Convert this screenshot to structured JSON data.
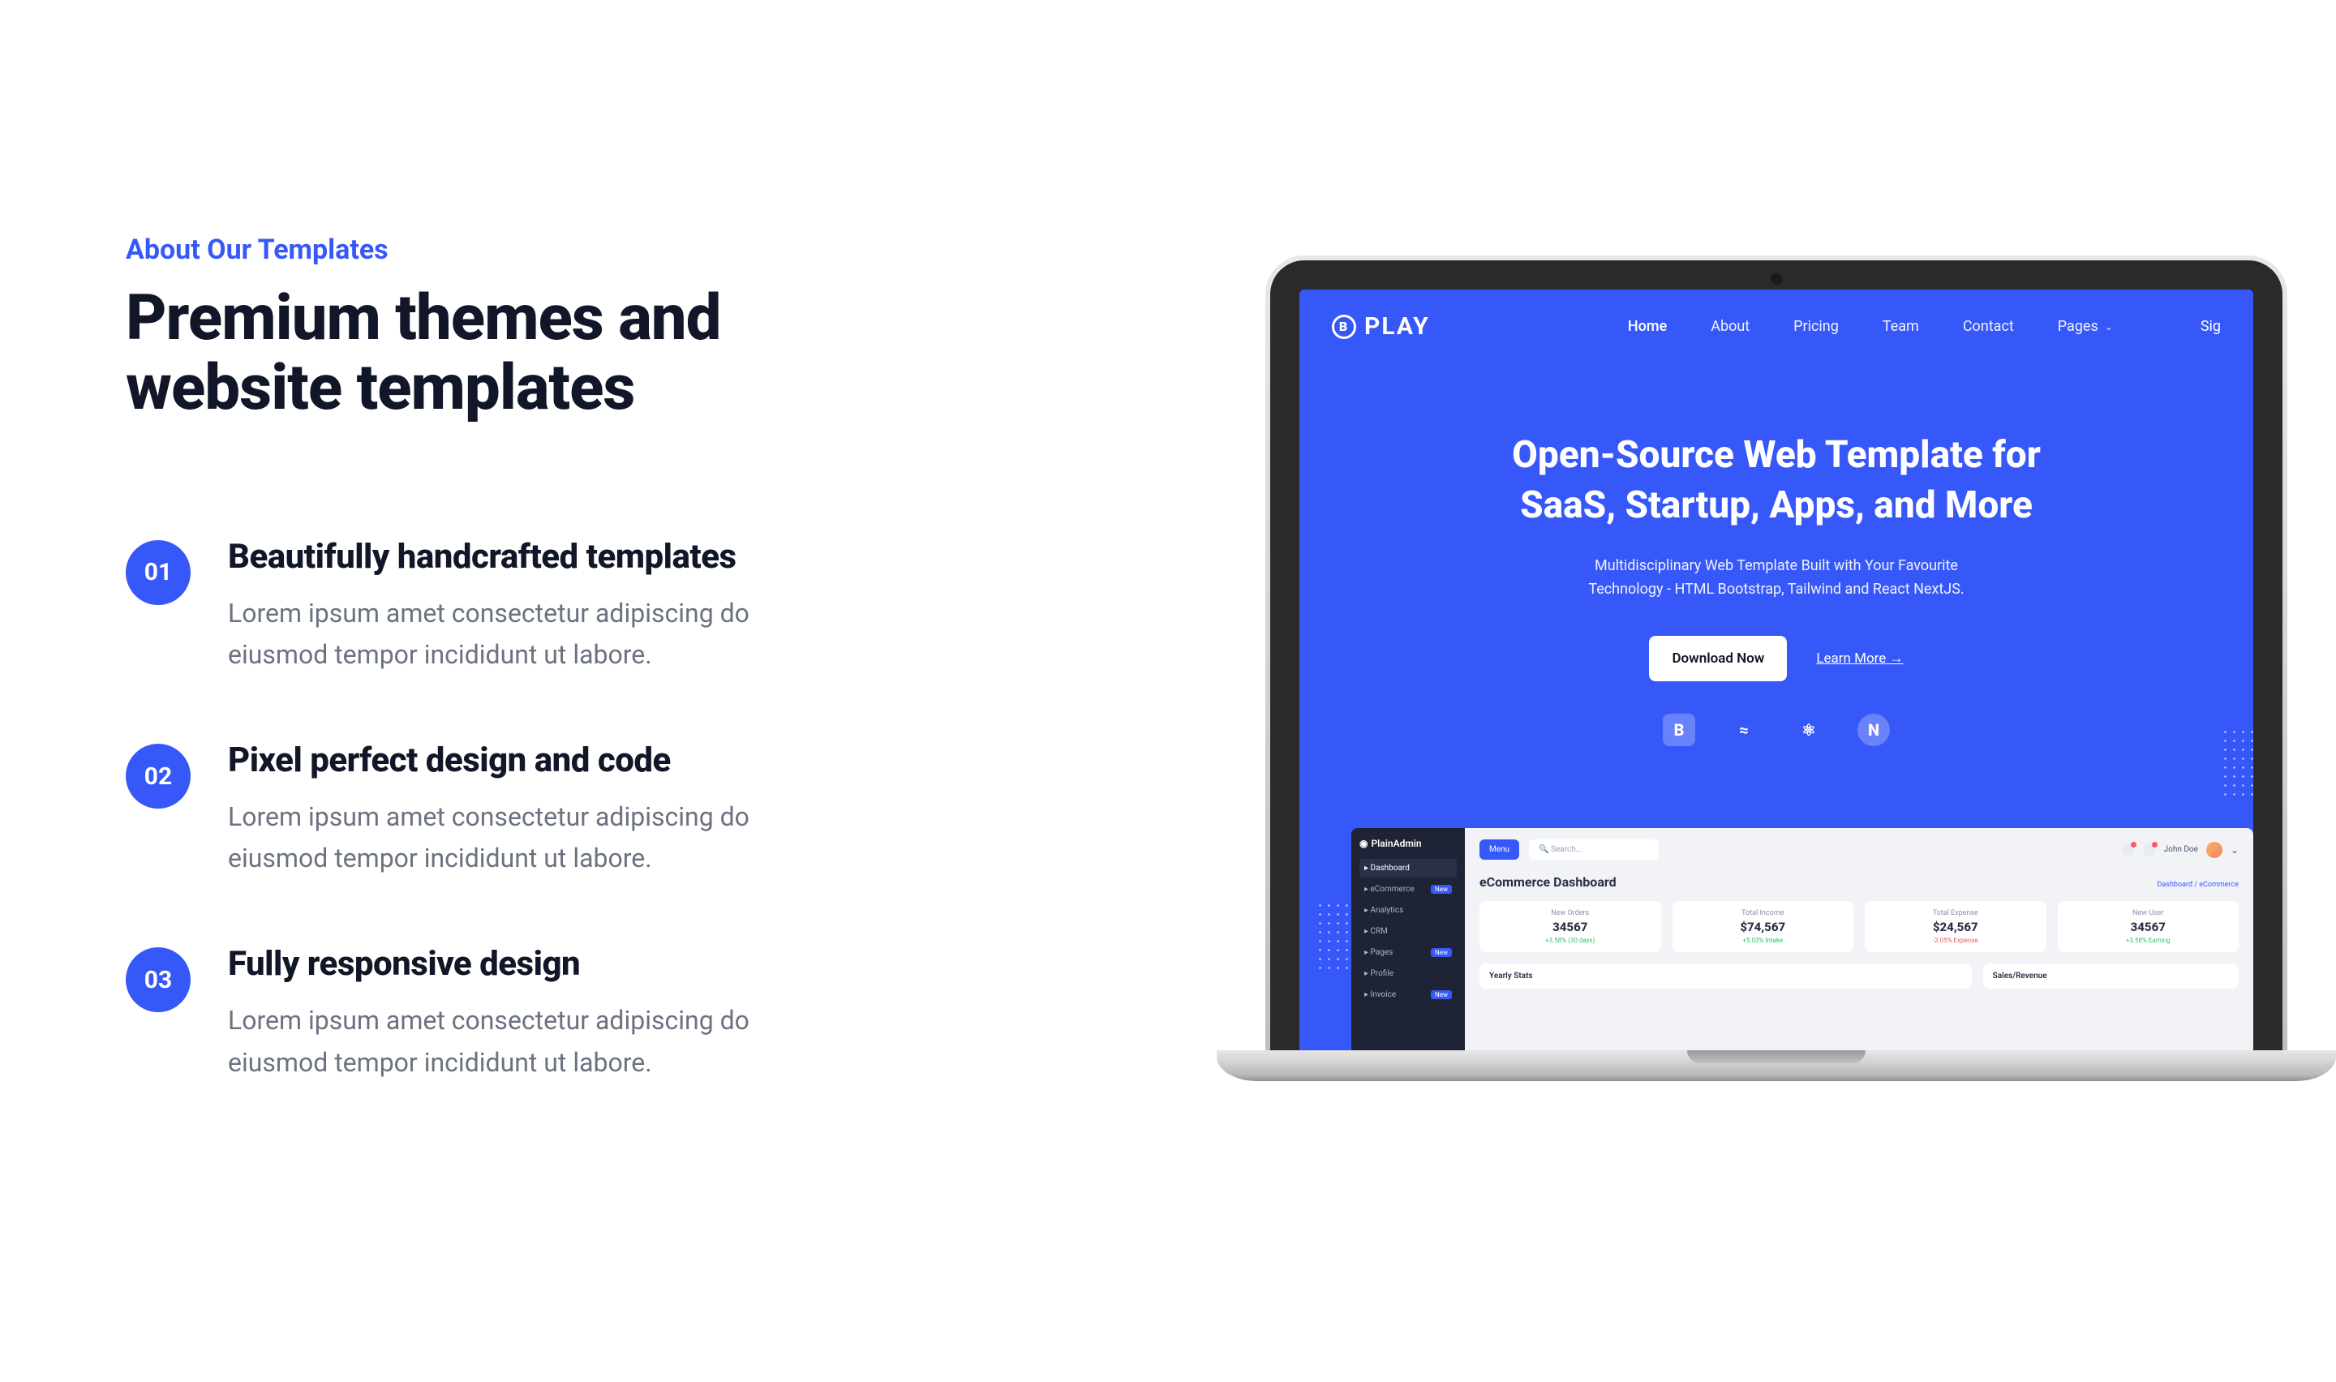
{
  "subtitle": "About Our Templates",
  "title_line1": "Premium themes and",
  "title_line2": "website templates",
  "features": [
    {
      "num": "01",
      "title": "Beautifully handcrafted templates",
      "desc": "Lorem ipsum amet consectetur adipiscing do eiusmod tempor incididunt ut labore."
    },
    {
      "num": "02",
      "title": "Pixel perfect design and code",
      "desc": "Lorem ipsum amet consectetur adipiscing do eiusmod tempor incididunt ut labore."
    },
    {
      "num": "03",
      "title": "Fully responsive design",
      "desc": "Lorem ipsum amet consectetur adipiscing do eiusmod tempor incididunt ut labore."
    }
  ],
  "mock": {
    "logo": "PLAY",
    "nav": {
      "home": "Home",
      "about": "About",
      "pricing": "Pricing",
      "team": "Team",
      "contact": "Contact",
      "pages": "Pages",
      "signin": "Sig"
    },
    "hero": {
      "line1": "Open-Source Web Template for",
      "line2": "SaaS, Startup, Apps, and More",
      "sub1": "Multidisciplinary Web Template Built with Your Favourite",
      "sub2": "Technology - HTML Bootstrap, Tailwind and React NextJS.",
      "btn_primary": "Download Now",
      "btn_link": "Learn More"
    },
    "tech": [
      "B",
      "≈",
      "⚛",
      "N"
    ],
    "dashboard": {
      "brand": "PlainAdmin",
      "sidebar": [
        {
          "label": "Dashboard",
          "active": true,
          "badge": ""
        },
        {
          "label": "eCommerce",
          "active": false,
          "badge": "New"
        },
        {
          "label": "Analytics",
          "active": false,
          "badge": ""
        },
        {
          "label": "CRM",
          "active": false,
          "badge": ""
        },
        {
          "label": "Pages",
          "active": false,
          "badge": "New"
        },
        {
          "label": "Profile",
          "active": false,
          "badge": ""
        },
        {
          "label": "Invoice",
          "active": false,
          "badge": "New"
        }
      ],
      "menu_btn": "Menu",
      "search": "Search...",
      "user": "John Doe",
      "title": "eCommerce Dashboard",
      "breadcrumb": "Dashboard / ",
      "breadcrumb_last": "eCommerce",
      "stats": [
        {
          "label": "New Orders",
          "value": "34567",
          "sub": "+3.58% (30 days)",
          "trend": "green"
        },
        {
          "label": "Total Income",
          "value": "$74,567",
          "sub": "+5.03% Intake",
          "trend": "green"
        },
        {
          "label": "Total Expense",
          "value": "$24,567",
          "sub": "-2.05% Expense",
          "trend": "red"
        },
        {
          "label": "New User",
          "value": "34567",
          "sub": "+3.58% Earning",
          "trend": "green"
        }
      ],
      "bottom_left": "Yearly Stats",
      "bottom_right": "Sales/Revenue"
    }
  }
}
